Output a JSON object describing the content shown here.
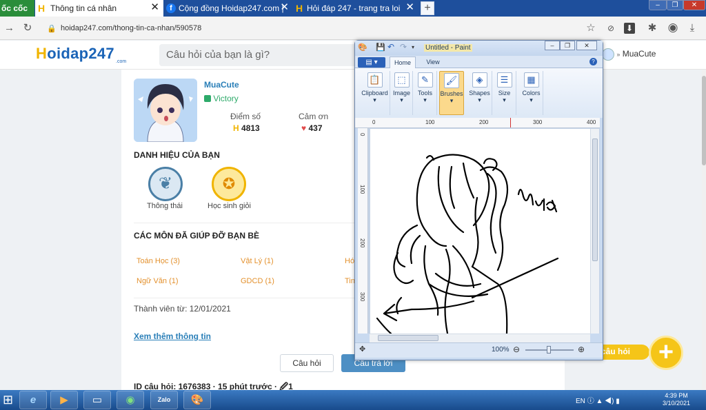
{
  "browser": {
    "brand_tab": "ốc cốc",
    "tabs": [
      {
        "label": "Thông tin cá nhân",
        "close": "✕"
      },
      {
        "label": "Cộng đồng Hoidap247.com |",
        "close": "✕"
      },
      {
        "label": "Hỏi đáp 247 - trang tra loi",
        "close": "✕"
      }
    ],
    "new_tab": "+",
    "url": "hoidap247.com/thong-tin-ca-nhan/590578",
    "window_controls": [
      "–",
      "❐",
      "✕"
    ]
  },
  "site": {
    "logo_h": "H",
    "logo_rest": "oidap247",
    "logo_domain": ".com",
    "search_placeholder": "Câu hỏi của bạn là gì?",
    "header_username": "MuaCute"
  },
  "profile": {
    "name": "MuaCute",
    "rank": "Victory",
    "score_label": "Điểm số",
    "score_value": "4813",
    "thanks_label": "Cảm ơn",
    "thanks_value": "437",
    "titles_heading": "DANH HIỆU CỦA BẠN",
    "badges": [
      {
        "label": "Thông thái",
        "icon": "wheat-icon",
        "color": "#4a7fa6"
      },
      {
        "label": "Học sinh giỏi",
        "icon": "medal-icon",
        "color": "#f0b400"
      }
    ],
    "subjects_heading": "CÁC MÔN ĐÃ GIÚP ĐỠ BẠN BÈ",
    "subjects": [
      "Toán Học (3)",
      "Vật Lý (1)",
      "Hó",
      "Ngữ Văn (1)",
      "GDCD (1)",
      "Tin"
    ],
    "member_since": "Thành viên từ: 12/01/2021",
    "more_info": "Xem thêm thông tin",
    "tab_questions": "Câu hỏi",
    "tab_answers": "Câu trả lời",
    "question_meta": "ID câu hỏi: 1676383 · 15 phút trước · 🖉1"
  },
  "floating": {
    "ask_label": "câu hỏi",
    "plus": "+"
  },
  "paint": {
    "title": "Untitled - Paint",
    "file_menu": "▤ ▾",
    "tabs": [
      "Home",
      "View"
    ],
    "groups": [
      {
        "label": "Clipboard",
        "icon": "clipboard-icon",
        "glyph": "📋"
      },
      {
        "label": "Image",
        "icon": "image-select-icon",
        "glyph": "⬚"
      },
      {
        "label": "Tools",
        "icon": "tools-icon",
        "glyph": "✎"
      },
      {
        "label": "Brushes",
        "icon": "brush-icon",
        "glyph": "🖌"
      },
      {
        "label": "Shapes",
        "icon": "shapes-icon",
        "glyph": "◈"
      },
      {
        "label": "Size",
        "icon": "size-icon",
        "glyph": "☰"
      },
      {
        "label": "Colors",
        "icon": "colors-icon",
        "glyph": "▦"
      }
    ],
    "ruler_h": [
      "0",
      "100",
      "200",
      "300",
      "400"
    ],
    "ruler_v": [
      "0",
      "100",
      "200",
      "300"
    ],
    "signature_text": "Mưa",
    "zoom": "100%",
    "zoom_minus": "⊖",
    "zoom_plus": "⊕",
    "accent": "#fbd98c"
  },
  "taskbar": {
    "apps": [
      {
        "icon": "windows-icon",
        "glyph": "⊞"
      },
      {
        "icon": "ie-icon",
        "glyph": "e"
      },
      {
        "icon": "media-player-icon",
        "glyph": "▶"
      },
      {
        "icon": "computer-icon",
        "glyph": "▭"
      },
      {
        "icon": "coccoc-icon",
        "glyph": "◉"
      },
      {
        "icon": "zalo-icon",
        "glyph": "Zalo"
      },
      {
        "icon": "paint-icon",
        "glyph": "🎨"
      }
    ],
    "language": "EN",
    "time": "4:39 PM",
    "date": "3/10/2021"
  }
}
